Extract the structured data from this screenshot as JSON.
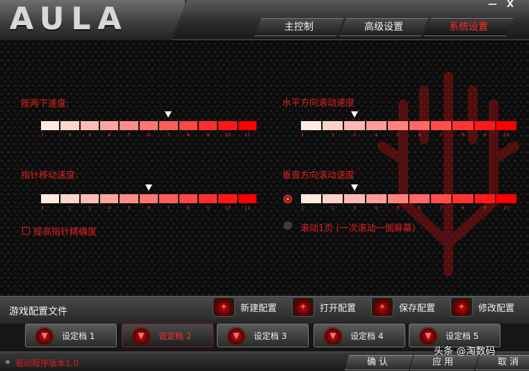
{
  "header": {
    "logo": "AULA",
    "window_controls": {
      "minimize": "—",
      "close": "X"
    },
    "tabs": [
      {
        "label": "主控制",
        "active": false
      },
      {
        "label": "高级设置",
        "active": false
      },
      {
        "label": "系统设置",
        "active": true
      }
    ]
  },
  "main": {
    "double_click_speed": {
      "label": "按两下速度:",
      "ticks": [
        "1",
        "2",
        "3",
        "4",
        "5",
        "6",
        "7",
        "8",
        "9",
        "10",
        "11"
      ],
      "value": 7
    },
    "pointer_speed": {
      "label": "指针移动速度:",
      "ticks": [
        "1",
        "2",
        "3",
        "4",
        "5",
        "6",
        "7",
        "8",
        "9",
        "10",
        "11"
      ],
      "value": 6
    },
    "enhance_precision": {
      "label": "提高指针精确度",
      "checked": false
    },
    "horizontal_scroll": {
      "label": "水平方向滚动速度",
      "ticks": [
        "1",
        "2",
        "3",
        "4",
        "5",
        "6",
        "7",
        "8",
        "9",
        "10"
      ],
      "value": 3
    },
    "vertical_scroll": {
      "label": "垂直方向滚动速度",
      "ticks": [
        "1",
        "2",
        "3",
        "4",
        "5",
        "6",
        "7",
        "8",
        "9",
        "10"
      ],
      "value": 3,
      "selected": true
    },
    "scroll_page": {
      "label": "滚动1页 (一次滚动一個屏幕)",
      "selected": false
    }
  },
  "profiles": {
    "title": "游戏配置文件",
    "actions": [
      {
        "label": "新建配置",
        "icon": "new-icon"
      },
      {
        "label": "打开配置",
        "icon": "open-icon"
      },
      {
        "label": "保存配置",
        "icon": "save-icon"
      },
      {
        "label": "修改配置",
        "icon": "edit-icon"
      }
    ],
    "slots": [
      {
        "label": "设定档 1",
        "active": false
      },
      {
        "label": "设定档 2",
        "active": true
      },
      {
        "label": "设定档 3",
        "active": false
      },
      {
        "label": "设定档 4",
        "active": false
      },
      {
        "label": "设定档 5",
        "active": false
      }
    ]
  },
  "footer": {
    "version": "驱动程序版本1.0",
    "buttons": [
      "确认",
      "应用",
      "取消"
    ]
  },
  "watermark": "头条 @淘数码",
  "colors": {
    "accent": "#e02020",
    "active_tab": "#ff2a2a"
  }
}
